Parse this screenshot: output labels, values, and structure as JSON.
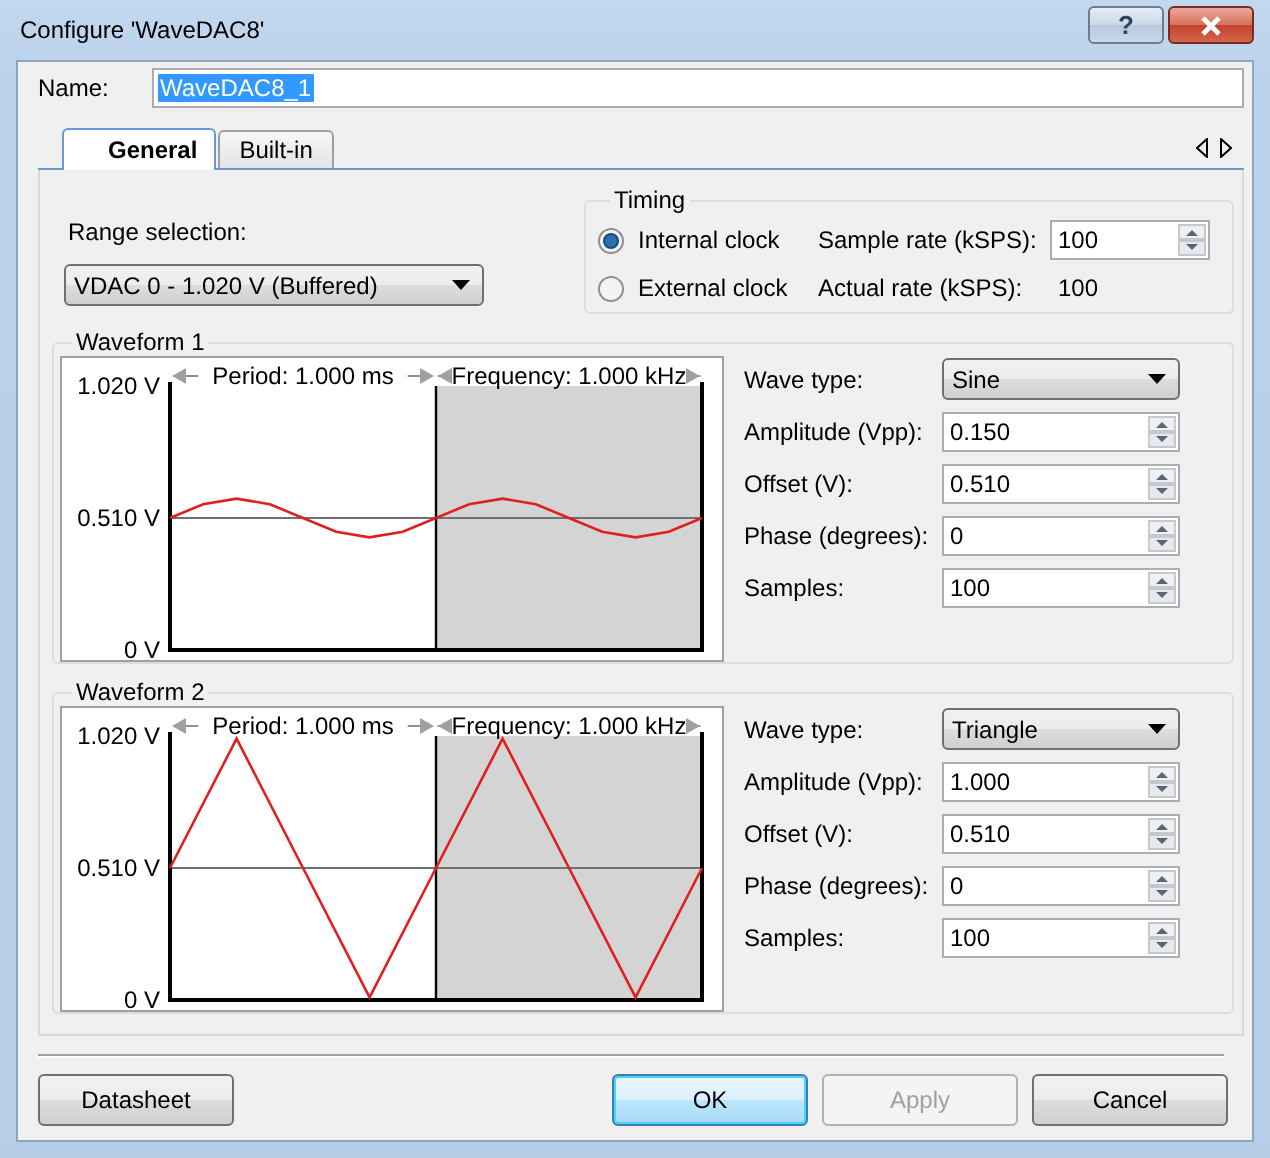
{
  "window": {
    "title": "Configure 'WaveDAC8'",
    "help": "?"
  },
  "name": {
    "label": "Name:",
    "value": "WaveDAC8_1",
    "highlighted": true
  },
  "tabs": [
    {
      "label": "General",
      "selected": true
    },
    {
      "label": "Built-in",
      "selected": false
    }
  ],
  "range": {
    "label": "Range selection:",
    "value": "VDAC 0 - 1.020 V (Buffered)"
  },
  "timing": {
    "title": "Timing",
    "clocks": [
      {
        "label": "Internal clock",
        "selected": true
      },
      {
        "label": "External clock",
        "selected": false
      }
    ],
    "sample_rate": {
      "label": "Sample rate (kSPS):",
      "value": "100"
    },
    "actual_rate": {
      "label": "Actual rate (kSPS):",
      "value": "100"
    }
  },
  "waveforms": [
    {
      "title": "Waveform 1",
      "period": "Period: 1.000 ms",
      "frequency": "Frequency: 1.000 kHz",
      "wave_type": {
        "label": "Wave type:",
        "value": "Sine"
      },
      "fields": [
        {
          "label": "Amplitude (Vpp):",
          "value": "0.150"
        },
        {
          "label": "Offset (V):",
          "value": "0.510"
        },
        {
          "label": "Phase (degrees):",
          "value": "0"
        },
        {
          "label": "Samples:",
          "value": "100"
        }
      ],
      "chart_data": {
        "type": "line",
        "categories": [
          null,
          null,
          null,
          null,
          null,
          null,
          null,
          null,
          null,
          null,
          null,
          null,
          null,
          null,
          null,
          null,
          null
        ],
        "ylim": [
          0,
          1.02
        ],
        "ref_lines": [
          {
            "axis": "y",
            "value": 0.51,
            "color": "#707070"
          }
        ],
        "yticks": [
          {
            "value": 1.02,
            "label": "1.020 V"
          },
          {
            "value": 0.51,
            "label": "0.510 V"
          },
          {
            "value": 0,
            "label": "0 V"
          }
        ],
        "series": [
          {
            "color": "#e02020",
            "values": [
              0.51,
              0.563,
              0.585,
              0.563,
              0.51,
              0.457,
              0.435,
              0.457,
              0.51,
              0.563,
              0.585,
              0.563,
              0.51,
              0.457,
              0.435,
              0.457,
              0.51
            ]
          }
        ]
      }
    },
    {
      "title": "Waveform 2",
      "period": "Period: 1.000 ms",
      "frequency": "Frequency: 1.000 kHz",
      "wave_type": {
        "label": "Wave type:",
        "value": "Triangle"
      },
      "fields": [
        {
          "label": "Amplitude (Vpp):",
          "value": "1.000"
        },
        {
          "label": "Offset (V):",
          "value": "0.510"
        },
        {
          "label": "Phase (degrees):",
          "value": "0"
        },
        {
          "label": "Samples:",
          "value": "100"
        }
      ],
      "chart_data": {
        "type": "line",
        "categories": [
          null,
          null,
          null,
          null,
          null,
          null,
          null,
          null,
          null
        ],
        "ylim": [
          0,
          1.02
        ],
        "ref_lines": [
          {
            "axis": "y",
            "value": 0.51,
            "color": "#707070"
          }
        ],
        "yticks": [
          {
            "value": 1.02,
            "label": "1.020 V"
          },
          {
            "value": 0.51,
            "label": "0.510 V"
          },
          {
            "value": 0,
            "label": "0 V"
          }
        ],
        "series": [
          {
            "color": "#e02020",
            "values": [
              0.51,
              1.01,
              0.51,
              0.01,
              0.51,
              1.01,
              0.51,
              0.01,
              0.51
            ]
          }
        ]
      }
    }
  ],
  "buttons": [
    {
      "label": "Datasheet",
      "default": false,
      "disabled": false
    },
    {
      "label": "OK",
      "default": true,
      "disabled": false
    },
    {
      "label": "Apply",
      "default": false,
      "disabled": true
    },
    {
      "label": "Cancel",
      "default": false,
      "disabled": false
    }
  ]
}
